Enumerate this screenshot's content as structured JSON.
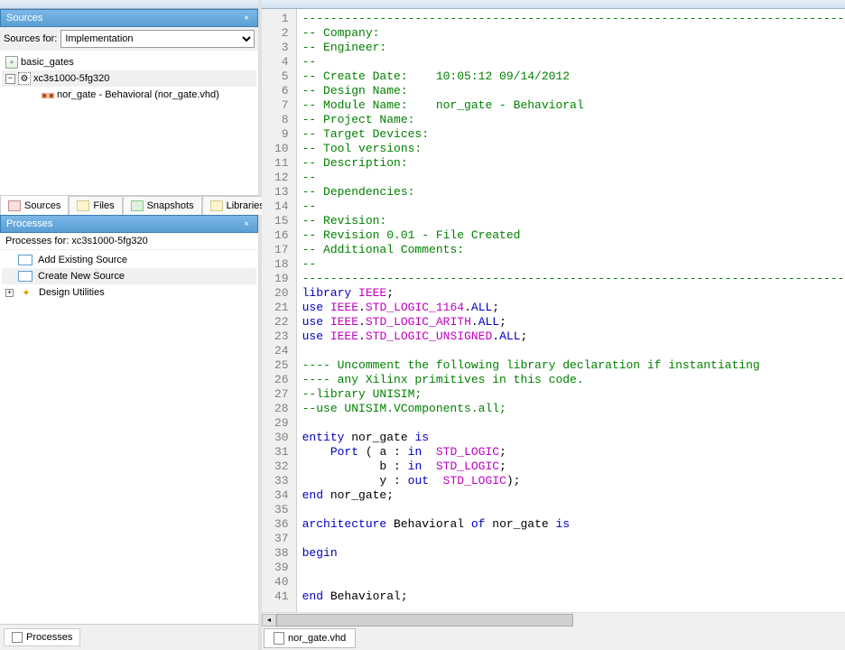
{
  "sources": {
    "title": "Sources",
    "for_label": "Sources for:",
    "for_value": "Implementation",
    "tree": {
      "root": "basic_gates",
      "device": "xc3s1000-5fg320",
      "file": "nor_gate - Behavioral (nor_gate.vhd)"
    },
    "tabs": [
      "Sources",
      "Files",
      "Snapshots",
      "Libraries"
    ]
  },
  "processes": {
    "title": "Processes",
    "for_label": "Processes for: xc3s1000-5fg320",
    "items": [
      "Add Existing Source",
      "Create New Source",
      "Design Utilities"
    ],
    "bottom_tab": "Processes"
  },
  "editor": {
    "filename": "nor_gate.vhd",
    "lines": [
      {
        "n": 1,
        "type": "comment",
        "text": "----------------------------------------------------------------------------------"
      },
      {
        "n": 2,
        "type": "comment",
        "text": "-- Company: "
      },
      {
        "n": 3,
        "type": "comment",
        "text": "-- Engineer: "
      },
      {
        "n": 4,
        "type": "comment",
        "text": "-- "
      },
      {
        "n": 5,
        "type": "comment",
        "text": "-- Create Date:    10:05:12 09/14/2012 "
      },
      {
        "n": 6,
        "type": "comment",
        "text": "-- Design Name: "
      },
      {
        "n": 7,
        "type": "comment",
        "text": "-- Module Name:    nor_gate - Behavioral "
      },
      {
        "n": 8,
        "type": "comment",
        "text": "-- Project Name: "
      },
      {
        "n": 9,
        "type": "comment",
        "text": "-- Target Devices: "
      },
      {
        "n": 10,
        "type": "comment",
        "text": "-- Tool versions: "
      },
      {
        "n": 11,
        "type": "comment",
        "text": "-- Description: "
      },
      {
        "n": 12,
        "type": "comment",
        "text": "--"
      },
      {
        "n": 13,
        "type": "comment",
        "text": "-- Dependencies: "
      },
      {
        "n": 14,
        "type": "comment",
        "text": "--"
      },
      {
        "n": 15,
        "type": "comment",
        "text": "-- Revision: "
      },
      {
        "n": 16,
        "type": "comment",
        "text": "-- Revision 0.01 - File Created"
      },
      {
        "n": 17,
        "type": "comment",
        "text": "-- Additional Comments: "
      },
      {
        "n": 18,
        "type": "comment",
        "text": "--"
      },
      {
        "n": 19,
        "type": "comment",
        "text": "----------------------------------------------------------------------------------"
      },
      {
        "n": 20,
        "type": "code",
        "tokens": [
          {
            "t": "library",
            "c": "keyword"
          },
          {
            "t": " "
          },
          {
            "t": "IEEE",
            "c": "lib"
          },
          {
            "t": ";"
          }
        ]
      },
      {
        "n": 21,
        "type": "code",
        "tokens": [
          {
            "t": "use",
            "c": "keyword"
          },
          {
            "t": " "
          },
          {
            "t": "IEEE",
            "c": "lib"
          },
          {
            "t": "."
          },
          {
            "t": "STD_LOGIC_1164",
            "c": "type"
          },
          {
            "t": "."
          },
          {
            "t": "ALL",
            "c": "keyword"
          },
          {
            "t": ";"
          }
        ]
      },
      {
        "n": 22,
        "type": "code",
        "tokens": [
          {
            "t": "use",
            "c": "keyword"
          },
          {
            "t": " "
          },
          {
            "t": "IEEE",
            "c": "lib"
          },
          {
            "t": "."
          },
          {
            "t": "STD_LOGIC_ARITH",
            "c": "type"
          },
          {
            "t": "."
          },
          {
            "t": "ALL",
            "c": "keyword"
          },
          {
            "t": ";"
          }
        ]
      },
      {
        "n": 23,
        "type": "code",
        "tokens": [
          {
            "t": "use",
            "c": "keyword"
          },
          {
            "t": " "
          },
          {
            "t": "IEEE",
            "c": "lib"
          },
          {
            "t": "."
          },
          {
            "t": "STD_LOGIC_UNSIGNED",
            "c": "type"
          },
          {
            "t": "."
          },
          {
            "t": "ALL",
            "c": "keyword"
          },
          {
            "t": ";"
          }
        ]
      },
      {
        "n": 24,
        "type": "blank",
        "text": ""
      },
      {
        "n": 25,
        "type": "comment",
        "text": "---- Uncomment the following library declaration if instantiating"
      },
      {
        "n": 26,
        "type": "comment",
        "text": "---- any Xilinx primitives in this code."
      },
      {
        "n": 27,
        "type": "comment",
        "text": "--library UNISIM;"
      },
      {
        "n": 28,
        "type": "comment",
        "text": "--use UNISIM.VComponents.all;"
      },
      {
        "n": 29,
        "type": "blank",
        "text": ""
      },
      {
        "n": 30,
        "type": "code",
        "tokens": [
          {
            "t": "entity",
            "c": "keyword"
          },
          {
            "t": " nor_gate "
          },
          {
            "t": "is",
            "c": "keyword"
          }
        ]
      },
      {
        "n": 31,
        "type": "code",
        "tokens": [
          {
            "t": "    "
          },
          {
            "t": "Port",
            "c": "keyword"
          },
          {
            "t": " ( a : "
          },
          {
            "t": "in",
            "c": "keyword"
          },
          {
            "t": "  "
          },
          {
            "t": "STD_LOGIC",
            "c": "type"
          },
          {
            "t": ";"
          }
        ]
      },
      {
        "n": 32,
        "type": "code",
        "tokens": [
          {
            "t": "           b : "
          },
          {
            "t": "in",
            "c": "keyword"
          },
          {
            "t": "  "
          },
          {
            "t": "STD_LOGIC",
            "c": "type"
          },
          {
            "t": ";"
          }
        ]
      },
      {
        "n": 33,
        "type": "code",
        "tokens": [
          {
            "t": "           y : "
          },
          {
            "t": "out",
            "c": "keyword"
          },
          {
            "t": "  "
          },
          {
            "t": "STD_LOGIC",
            "c": "type"
          },
          {
            "t": ");"
          }
        ]
      },
      {
        "n": 34,
        "type": "code",
        "tokens": [
          {
            "t": "end",
            "c": "keyword"
          },
          {
            "t": " nor_gate;"
          }
        ]
      },
      {
        "n": 35,
        "type": "blank",
        "text": ""
      },
      {
        "n": 36,
        "type": "code",
        "tokens": [
          {
            "t": "architecture",
            "c": "keyword"
          },
          {
            "t": " Behavioral "
          },
          {
            "t": "of",
            "c": "keyword"
          },
          {
            "t": " nor_gate "
          },
          {
            "t": "is",
            "c": "keyword"
          }
        ]
      },
      {
        "n": 37,
        "type": "blank",
        "text": ""
      },
      {
        "n": 38,
        "type": "code",
        "tokens": [
          {
            "t": "begin",
            "c": "keyword"
          }
        ]
      },
      {
        "n": 39,
        "type": "blank",
        "text": ""
      },
      {
        "n": 40,
        "type": "blank",
        "text": ""
      },
      {
        "n": 41,
        "type": "code",
        "tokens": [
          {
            "t": "end",
            "c": "keyword"
          },
          {
            "t": " Behavioral;"
          }
        ]
      }
    ]
  }
}
